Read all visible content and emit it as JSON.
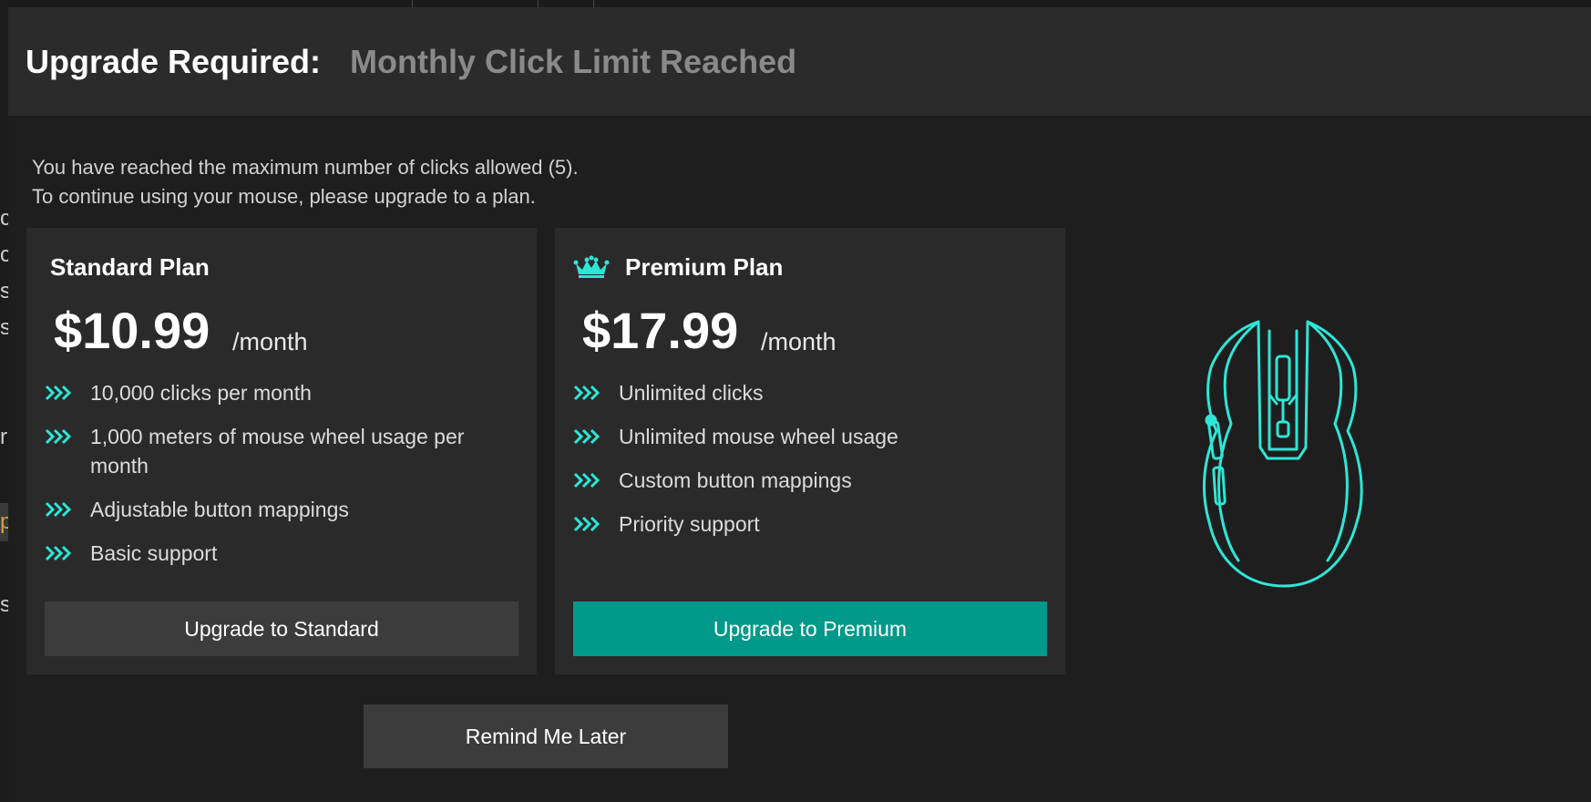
{
  "dialog": {
    "title": "Upgrade Required:",
    "subtitle": "Monthly Click Limit Reached",
    "message_line1": "You have reached the maximum number of clicks allowed (5).",
    "message_line2": "To continue using your mouse, please upgrade to a plan."
  },
  "plans": {
    "standard": {
      "name": "Standard Plan",
      "price": "$10.99",
      "period": "/month",
      "features": [
        "10,000 clicks per month",
        "1,000 meters of mouse wheel usage per month",
        "Adjustable button mappings",
        "Basic support"
      ],
      "button_label": "Upgrade to Standard"
    },
    "premium": {
      "name": "Premium Plan",
      "badge_icon": "crown-icon",
      "price": "$17.99",
      "period": "/month",
      "features": [
        "Unlimited clicks",
        "Unlimited mouse wheel usage",
        "Custom button mappings",
        "Priority support"
      ],
      "button_label": "Upgrade to Premium"
    }
  },
  "remind_label": "Remind Me Later",
  "illustration_icon": "mouse-icon",
  "colors": {
    "accent": "#2ee6d6",
    "premium_button": "#00998a",
    "card_bg": "#2a2a2a",
    "header_bg": "#2b2b2b"
  }
}
